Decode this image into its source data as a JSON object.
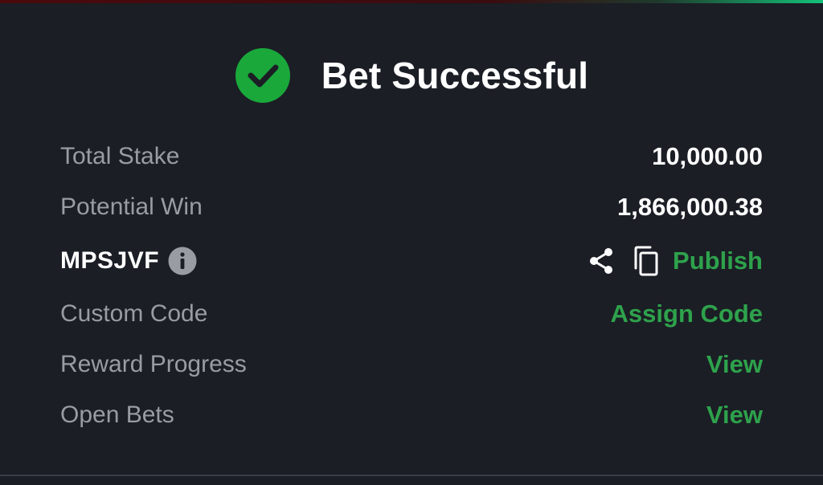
{
  "header": {
    "title": "Bet Successful",
    "icon": "check-circle-icon",
    "success_color": "#1aa83b"
  },
  "summary": {
    "total_stake_label": "Total Stake",
    "total_stake_value": "10,000.00",
    "potential_win_label": "Potential Win",
    "potential_win_value": "1,866,000.38",
    "booking_code": "MPSJVF",
    "publish_label": "Publish",
    "custom_code_label": "Custom Code",
    "assign_code_label": "Assign Code",
    "reward_progress_label": "Reward Progress",
    "reward_view_label": "View",
    "open_bets_label": "Open Bets",
    "open_bets_view_label": "View"
  },
  "icons": {
    "info": "info-icon",
    "share": "share-icon",
    "copy": "copy-icon"
  },
  "colors": {
    "background": "#1b1e25",
    "accent_green": "#2ea24c",
    "label_gray": "#9a9ca3",
    "text_white": "#ffffff"
  }
}
